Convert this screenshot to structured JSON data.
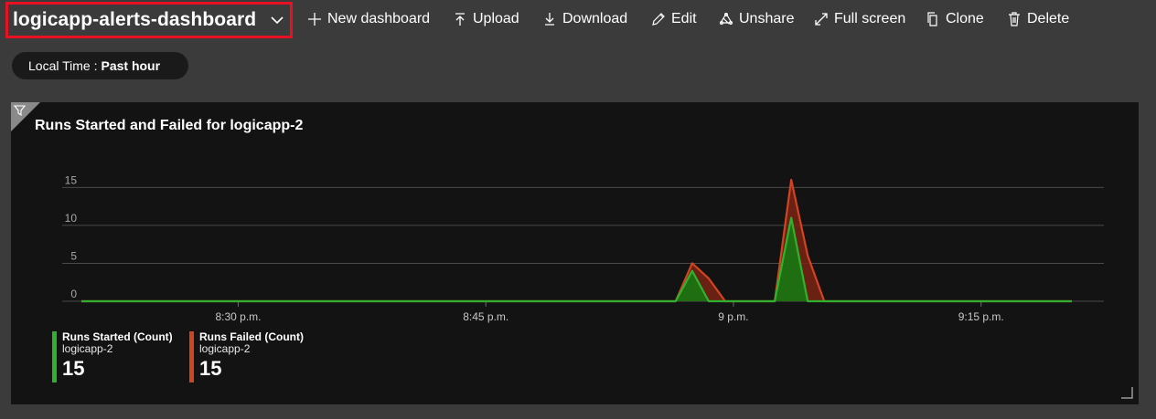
{
  "header": {
    "dashboard_name": "logicapp-alerts-dashboard",
    "actions": [
      {
        "id": "new",
        "label": "New dashboard",
        "icon": "plus-icon"
      },
      {
        "id": "upload",
        "label": "Upload",
        "icon": "upload-icon"
      },
      {
        "id": "download",
        "label": "Download",
        "icon": "download-icon"
      },
      {
        "id": "edit",
        "label": "Edit",
        "icon": "pencil-icon"
      },
      {
        "id": "unshare",
        "label": "Unshare",
        "icon": "unshare-icon"
      },
      {
        "id": "fullscreen",
        "label": "Full screen",
        "icon": "expand-icon"
      },
      {
        "id": "clone",
        "label": "Clone",
        "icon": "copy-icon"
      },
      {
        "id": "delete",
        "label": "Delete",
        "icon": "trash-icon"
      }
    ]
  },
  "time_filter": {
    "label": "Local Time :",
    "value": "Past hour"
  },
  "tile": {
    "title": "Runs Started and Failed for logicapp-2",
    "legend": [
      {
        "name": "Runs Started (Count)",
        "resource": "logicapp-2",
        "value": "15",
        "color": "#2fb12f"
      },
      {
        "name": "Runs Failed (Count)",
        "resource": "logicapp-2",
        "value": "15",
        "color": "#d0441f"
      }
    ]
  },
  "chart_data": {
    "type": "area",
    "x_tick_labels": [
      "8:30 p.m.",
      "8:45 p.m.",
      "9 p.m.",
      "9:15 p.m."
    ],
    "x_tick_minutes": [
      0,
      15,
      30,
      45
    ],
    "x_range_minutes": [
      -9.5,
      50.5
    ],
    "y_ticks": [
      0,
      5,
      10,
      15
    ],
    "ylim": [
      0,
      16
    ],
    "grid": true,
    "series": [
      {
        "name": "Runs Failed (Count)",
        "color": "#d0441f",
        "fill": "#7a2313",
        "points": [
          [
            -9.5,
            0
          ],
          [
            26.5,
            0
          ],
          [
            27.5,
            5
          ],
          [
            28.5,
            3
          ],
          [
            29.5,
            0
          ],
          [
            32.5,
            0
          ],
          [
            33.5,
            16
          ],
          [
            34.5,
            6
          ],
          [
            35.5,
            0
          ],
          [
            50.5,
            0
          ]
        ]
      },
      {
        "name": "Runs Started (Count)",
        "color": "#2fb12f",
        "fill": "#137d13",
        "points": [
          [
            -9.5,
            0
          ],
          [
            26.5,
            0
          ],
          [
            27.5,
            4
          ],
          [
            28.5,
            0
          ],
          [
            32.5,
            0
          ],
          [
            33.5,
            11
          ],
          [
            34.5,
            0
          ],
          [
            50.5,
            0
          ]
        ]
      }
    ]
  }
}
